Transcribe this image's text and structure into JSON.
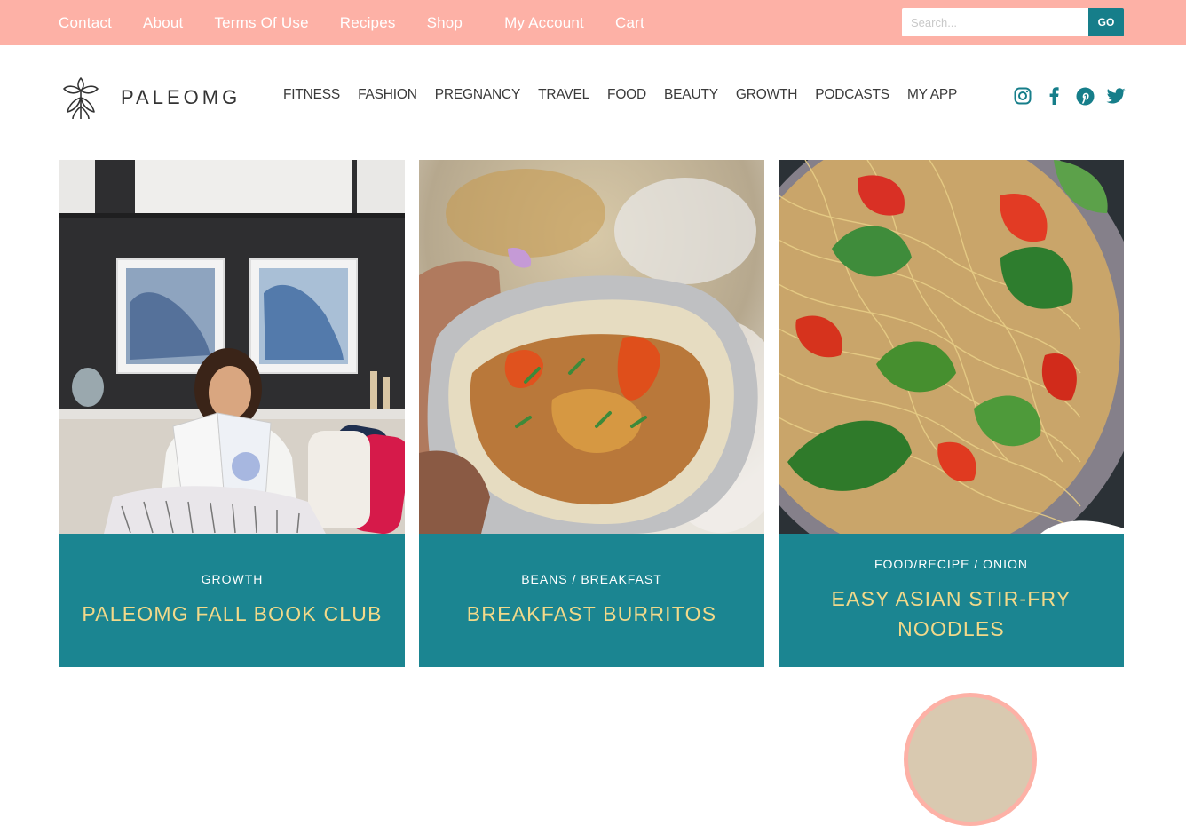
{
  "topbar": {
    "links": [
      "Contact",
      "About",
      "Terms Of Use",
      "Recipes",
      "Shop",
      "My Account",
      "Cart"
    ],
    "search_placeholder": "Search...",
    "go_label": "GO"
  },
  "header": {
    "logo_text": "PALEOMG",
    "nav": [
      "FITNESS",
      "FASHION",
      "PREGNANCY",
      "TRAVEL",
      "FOOD",
      "BEAUTY",
      "GROWTH",
      "PODCASTS",
      "MY APP"
    ],
    "social_icons": [
      "instagram-icon",
      "facebook-icon",
      "pinterest-icon",
      "twitter-icon"
    ]
  },
  "cards": [
    {
      "category": "GROWTH",
      "title": "PALEOMG FALL BOOK CLUB"
    },
    {
      "category": "BEANS / BREAKFAST",
      "title": "BREAKFAST BURRITOS"
    },
    {
      "category": "FOOD/RECIPE / ONION",
      "title": "EASY ASIAN STIR-FRY NOODLES"
    }
  ],
  "colors": {
    "topbar": "#fdb1a6",
    "accent": "#167e8a",
    "caption_bg": "#1b8591",
    "title_text": "#f2d98a"
  }
}
